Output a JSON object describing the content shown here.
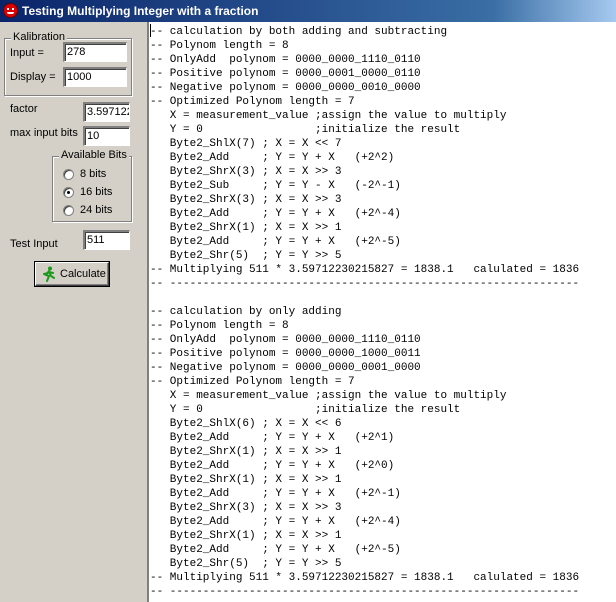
{
  "window": {
    "title": "Testing Multiplying Integer with a fraction"
  },
  "left": {
    "kalibration": {
      "caption": "Kalibration",
      "input_label": "Input =",
      "input_value": "278",
      "display_label": "Display =",
      "display_value": "1000"
    },
    "factor": {
      "label": "factor",
      "value": "3.597122"
    },
    "max_input_bits": {
      "label": "max input bits",
      "value": "10"
    },
    "available_bits": {
      "caption": "Available Bits",
      "options": [
        {
          "label": "8  bits",
          "checked": false
        },
        {
          "label": "16 bits",
          "checked": true
        },
        {
          "label": "24 bits",
          "checked": false
        }
      ]
    },
    "test_input": {
      "label": "Test Input",
      "value": "511"
    },
    "calculate_label": "Calculate"
  },
  "code_lines": [
    "-- calculation by both adding and subtracting",
    "-- Polynom length = 8",
    "-- OnlyAdd  polynom = 0000_0000_1110_0110",
    "-- Positive polynom = 0000_0001_0000_0110",
    "-- Negative polynom = 0000_0000_0010_0000",
    "-- Optimized Polynom length = 7",
    "   X = measurement_value ;assign the value to multiply",
    "   Y = 0                 ;initialize the result",
    "   Byte2_ShlX(7) ; X = X << 7",
    "   Byte2_Add     ; Y = Y + X   (+2^2)",
    "   Byte2_ShrX(3) ; X = X >> 3",
    "   Byte2_Sub     ; Y = Y - X   (-2^-1)",
    "   Byte2_ShrX(3) ; X = X >> 3",
    "   Byte2_Add     ; Y = Y + X   (+2^-4)",
    "   Byte2_ShrX(1) ; X = X >> 1",
    "   Byte2_Add     ; Y = Y + X   (+2^-5)",
    "   Byte2_Shr(5)  ; Y = Y >> 5",
    "-- Multiplying 511 * 3.59712230215827 = 1838.1   calulated = 1836",
    "-- --------------------------------------------------------------",
    "",
    "-- calculation by only adding",
    "-- Polynom length = 8",
    "-- OnlyAdd  polynom = 0000_0000_1110_0110",
    "-- Positive polynom = 0000_0000_1000_0011",
    "-- Negative polynom = 0000_0000_0001_0000",
    "-- Optimized Polynom length = 7",
    "   X = measurement_value ;assign the value to multiply",
    "   Y = 0                 ;initialize the result",
    "   Byte2_ShlX(6) ; X = X << 6",
    "   Byte2_Add     ; Y = Y + X   (+2^1)",
    "   Byte2_ShrX(1) ; X = X >> 1",
    "   Byte2_Add     ; Y = Y + X   (+2^0)",
    "   Byte2_ShrX(1) ; X = X >> 1",
    "   Byte2_Add     ; Y = Y + X   (+2^-1)",
    "   Byte2_ShrX(3) ; X = X >> 3",
    "   Byte2_Add     ; Y = Y + X   (+2^-4)",
    "   Byte2_ShrX(1) ; X = X >> 1",
    "   Byte2_Add     ; Y = Y + X   (+2^-5)",
    "   Byte2_Shr(5)  ; Y = Y >> 5",
    "-- Multiplying 511 * 3.59712230215827 = 1838.1   calulated = 1836",
    "-- --------------------------------------------------------------"
  ]
}
